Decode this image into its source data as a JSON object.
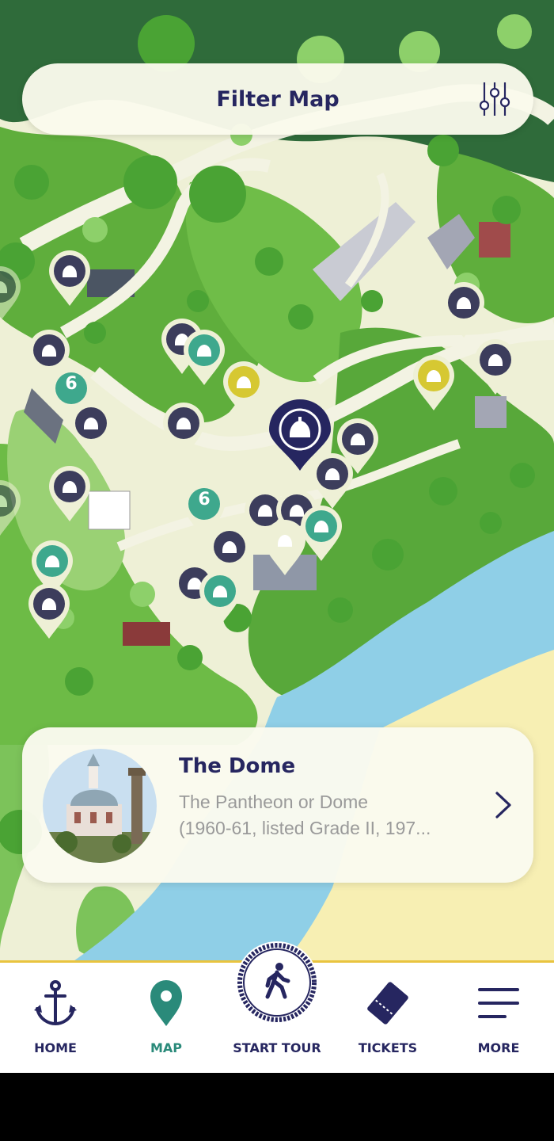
{
  "filter": {
    "title": "Filter Map",
    "icon": "sliders-icon"
  },
  "map": {
    "colors": {
      "path": "#eef0d6",
      "grass": "#7cc35a",
      "tree": "#4aa334",
      "water": "#8fcfe7",
      "sand": "#f7efb3",
      "pin_dark": "#3c3d5c",
      "pin_teal": "#3ea88d",
      "pin_yellow": "#d6c832",
      "pin_selected": "#262660"
    },
    "cluster_label": "6"
  },
  "card": {
    "title": "The Dome",
    "desc_line1": "The Pantheon or Dome",
    "desc_line2": "(1960-61, listed Grade II, 197...",
    "chevron": "chevron-right-icon"
  },
  "tabs": {
    "home": "HOME",
    "map": "MAP",
    "start_tour": "START TOUR",
    "tickets": "TICKETS",
    "more": "MORE"
  }
}
